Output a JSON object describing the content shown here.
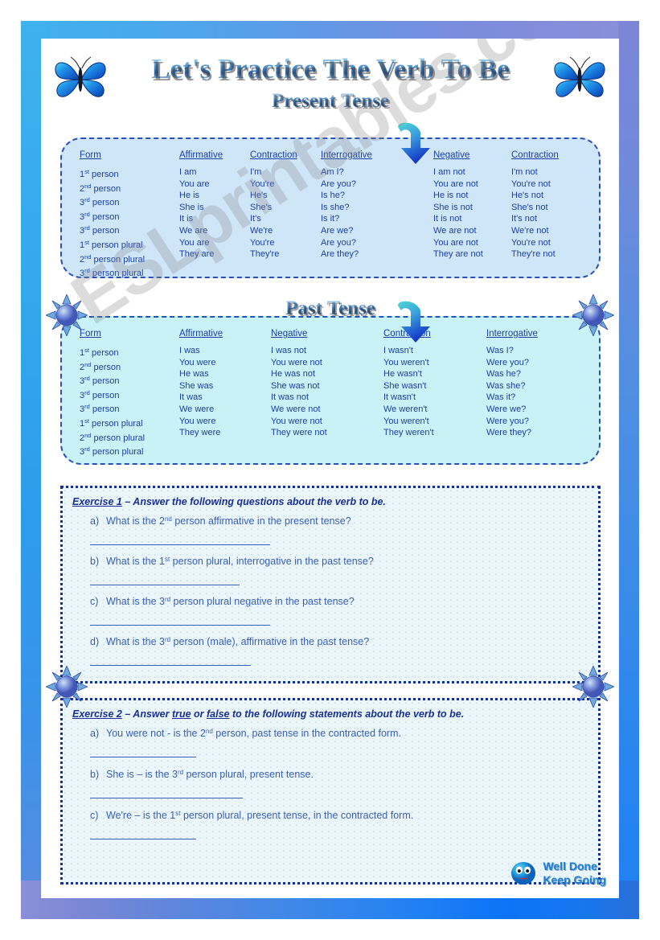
{
  "header": {
    "title": "Let's Practice The Verb To Be",
    "subtitle": "Present Tense",
    "past_subtitle": "Past Tense"
  },
  "watermark": "ESLprintables.com",
  "present_table": {
    "columns": [
      "Form",
      "Affirmative",
      "Contraction",
      "Interrogative",
      "Negative",
      "Contraction"
    ],
    "rows": [
      {
        "form_num": "1",
        "form_ord": "st",
        "form_rest": " person",
        "affirmative": "I am",
        "contraction": "I'm",
        "interrogative": "Am I?",
        "negative": "I am not",
        "neg_contraction": "I'm not"
      },
      {
        "form_num": "2",
        "form_ord": "nd",
        "form_rest": " person",
        "affirmative": "You are",
        "contraction": "You're",
        "interrogative": "Are you?",
        "negative": "You are not",
        "neg_contraction": "You're not"
      },
      {
        "form_num": "3",
        "form_ord": "rd",
        "form_rest": " person",
        "affirmative": "He is",
        "contraction": "He's",
        "interrogative": "Is he?",
        "negative": "He is not",
        "neg_contraction": "He's not"
      },
      {
        "form_num": "3",
        "form_ord": "rd",
        "form_rest": " person",
        "affirmative": "She is",
        "contraction": "She's",
        "interrogative": "Is she?",
        "negative": "She is not",
        "neg_contraction": "She's not"
      },
      {
        "form_num": "3",
        "form_ord": "rd",
        "form_rest": " person",
        "affirmative": "It is",
        "contraction": "It's",
        "interrogative": "Is it?",
        "negative": "It is not",
        "neg_contraction": "It's not"
      },
      {
        "form_num": "1",
        "form_ord": "st",
        "form_rest": " person plural",
        "affirmative": "We are",
        "contraction": "We're",
        "interrogative": "Are we?",
        "negative": "We are not",
        "neg_contraction": "We're not"
      },
      {
        "form_num": "2",
        "form_ord": "nd",
        "form_rest": " person plural",
        "affirmative": "You are",
        "contraction": "You're",
        "interrogative": "Are you?",
        "negative": "You are not",
        "neg_contraction": "You're not"
      },
      {
        "form_num": "3",
        "form_ord": "rd",
        "form_rest": " person plural",
        "affirmative": "They are",
        "contraction": "They're",
        "interrogative": "Are they?",
        "negative": "They are not",
        "neg_contraction": "They're not"
      }
    ]
  },
  "past_table": {
    "columns": [
      "Form",
      "Affirmative",
      "Negative",
      "Contraction",
      "Interrogative"
    ],
    "rows": [
      {
        "form_num": "1",
        "form_ord": "st",
        "form_rest": " person",
        "affirmative": "I was",
        "negative": "I was not",
        "contraction": "I wasn't",
        "interrogative": "Was I?"
      },
      {
        "form_num": "2",
        "form_ord": "nd",
        "form_rest": " person",
        "affirmative": "You were",
        "negative": "You were not",
        "contraction": "You weren't",
        "interrogative": "Were you?"
      },
      {
        "form_num": "3",
        "form_ord": "rd",
        "form_rest": " person",
        "affirmative": "He was",
        "negative": "He was not",
        "contraction": "He wasn't",
        "interrogative": "Was he?"
      },
      {
        "form_num": "3",
        "form_ord": "rd",
        "form_rest": " person",
        "affirmative": "She was",
        "negative": "She was not",
        "contraction": "She wasn't",
        "interrogative": "Was she?"
      },
      {
        "form_num": "3",
        "form_ord": "rd",
        "form_rest": " person",
        "affirmative": "It was",
        "negative": "It was not",
        "contraction": "It wasn't",
        "interrogative": "Was it?"
      },
      {
        "form_num": "1",
        "form_ord": "st",
        "form_rest": " person plural",
        "affirmative": "We were",
        "negative": "We were not",
        "contraction": "We weren't",
        "interrogative": "Were we?"
      },
      {
        "form_num": "2",
        "form_ord": "nd",
        "form_rest": " person plural",
        "affirmative": "You were",
        "negative": "You were not",
        "contraction": "You weren't",
        "interrogative": "Were you?"
      },
      {
        "form_num": "3",
        "form_ord": "rd",
        "form_rest": " person plural",
        "affirmative": "They were",
        "negative": "They were not",
        "contraction": "They weren't",
        "interrogative": "Were they?"
      }
    ]
  },
  "exercise1": {
    "label": "Exercise 1",
    "dash": " – ",
    "instruction": "Answer the following questions about the verb to be.",
    "questions": [
      {
        "label": "a)",
        "pre": "What is the 2",
        "ord": "nd",
        "post": " person affirmative in the present tense?",
        "blank_width": 224
      },
      {
        "label": "b)",
        "pre": "What is the 1",
        "ord": "st",
        "post": " person plural, interrogative in the past tense?",
        "blank_width": 186
      },
      {
        "label": "c)",
        "pre": "What is the 3",
        "ord": "rd",
        "post": " person plural negative in the past tense?",
        "blank_width": 224
      },
      {
        "label": "d)",
        "pre": "What is the 3",
        "ord": "rd",
        "post": " person (male), affirmative in the past tense?",
        "blank_width": 200
      }
    ]
  },
  "exercise2": {
    "label": "Exercise 2",
    "dash": " – ",
    "instruction_pre": "Answer ",
    "true_word": "true",
    "or_word": " or ",
    "false_word": "false",
    "instruction_post": " to the following statements about the verb to be.",
    "questions": [
      {
        "label": "a)",
        "pre": "You were not - is the 2",
        "ord": "nd",
        "post": " person, past tense in the contracted form.",
        "blank_width": 132
      },
      {
        "label": "b)",
        "pre": "She is – is the 3",
        "ord": "rd",
        "post": " person plural, present tense.",
        "blank_width": 190
      },
      {
        "label": "c)",
        "pre": "We're – is the 1",
        "ord": "st",
        "post": " person plural, present tense, in the contracted form.",
        "blank_width": 132
      }
    ]
  },
  "footer": {
    "line1": "Well Done",
    "line2": "Keep Going"
  },
  "colors": {
    "ink": "#1b3fa8",
    "heading": "#1a2f96",
    "question": "#3a5fb8",
    "present_bg": "#cfe6f9",
    "past_bg": "#c8f2f5",
    "exercise_bg": "#eaf6fa",
    "badge": "#1c7fd6"
  }
}
